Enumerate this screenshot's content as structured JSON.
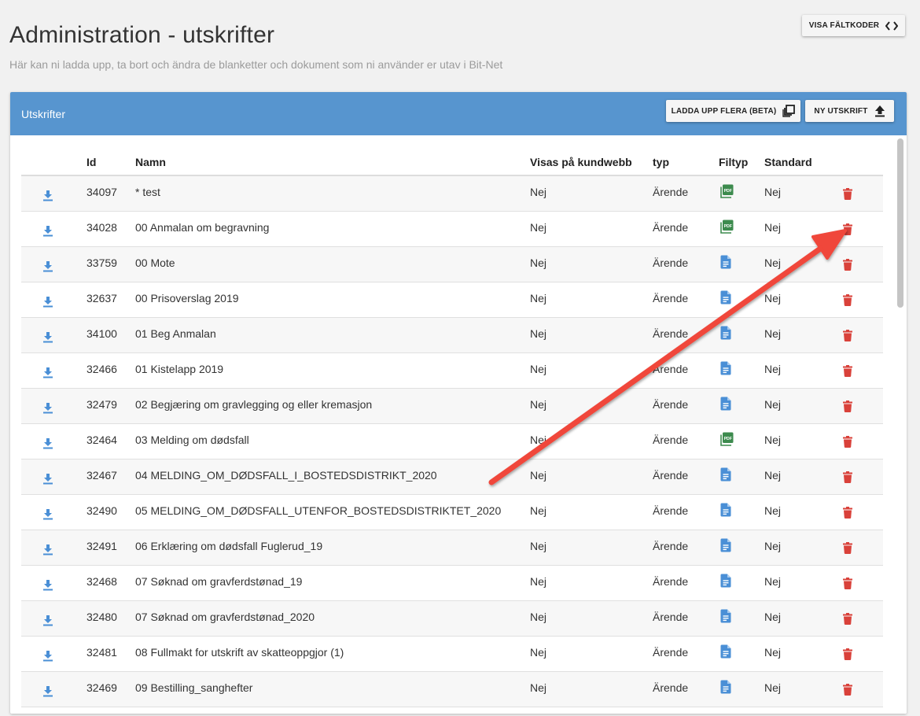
{
  "page": {
    "title": "Administration - utskrifter",
    "subtitle": "Här kan ni ladda upp, ta bort och ändra de blanketter och dokument som ni använder er utav i Bit-Net"
  },
  "toolbar": {
    "show_fields_label": "VISA FÄLTKODER"
  },
  "card": {
    "title": "Utskrifter",
    "upload_many_label": "LADDA UPP FLERA (BETA)",
    "new_label": "NY UTSKRIFT"
  },
  "table": {
    "headers": {
      "id": "Id",
      "name": "Namn",
      "visible": "Visas på kundwebb",
      "type": "typ",
      "filetype": "Filtyp",
      "standard": "Standard"
    },
    "rows": [
      {
        "id": "34097",
        "name": "* test",
        "visible": "Nej",
        "type": "Ärende",
        "file": "pdf",
        "standard": "Nej"
      },
      {
        "id": "34028",
        "name": "00 Anmalan om begravning",
        "visible": "Nej",
        "type": "Ärende",
        "file": "pdf",
        "standard": "Nej"
      },
      {
        "id": "33759",
        "name": "00 Mote",
        "visible": "Nej",
        "type": "Ärende",
        "file": "doc",
        "standard": "Nej"
      },
      {
        "id": "32637",
        "name": "00 Prisoverslag 2019",
        "visible": "Nej",
        "type": "Ärende",
        "file": "doc",
        "standard": "Nej"
      },
      {
        "id": "34100",
        "name": "01 Beg Anmalan",
        "visible": "Nej",
        "type": "Ärende",
        "file": "doc",
        "standard": "Nej"
      },
      {
        "id": "32466",
        "name": "01 Kistelapp 2019",
        "visible": "Nej",
        "type": "Ärende",
        "file": "doc",
        "standard": "Nej"
      },
      {
        "id": "32479",
        "name": "02 Begjæring om gravlegging og eller kremasjon",
        "visible": "Nej",
        "type": "Ärende",
        "file": "doc",
        "standard": "Nej"
      },
      {
        "id": "32464",
        "name": "03 Melding om dødsfall",
        "visible": "Nej",
        "type": "Ärende",
        "file": "pdf",
        "standard": "Nej"
      },
      {
        "id": "32467",
        "name": "04 MELDING_OM_DØDSFALL_I_BOSTEDSDISTRIKT_2020",
        "visible": "Nej",
        "type": "Ärende",
        "file": "doc",
        "standard": "Nej"
      },
      {
        "id": "32490",
        "name": "05 MELDING_OM_DØDSFALL_UTENFOR_BOSTEDSDISTRIKTET_2020",
        "visible": "Nej",
        "type": "Ärende",
        "file": "doc",
        "standard": "Nej"
      },
      {
        "id": "32491",
        "name": "06 Erklæring om dødsfall Fuglerud_19",
        "visible": "Nej",
        "type": "Ärende",
        "file": "doc",
        "standard": "Nej"
      },
      {
        "id": "32468",
        "name": "07 Søknad om gravferdstønad_19",
        "visible": "Nej",
        "type": "Ärende",
        "file": "doc",
        "standard": "Nej"
      },
      {
        "id": "32480",
        "name": "07 Søknad om gravferdstønad_2020",
        "visible": "Nej",
        "type": "Ärende",
        "file": "doc",
        "standard": "Nej"
      },
      {
        "id": "32481",
        "name": "08 Fullmakt for utskrift av skatteoppgjor (1)",
        "visible": "Nej",
        "type": "Ärende",
        "file": "doc",
        "standard": "Nej"
      },
      {
        "id": "32469",
        "name": "09 Bestilling_sanghefter",
        "visible": "Nej",
        "type": "Ärende",
        "file": "doc",
        "standard": "Nej"
      }
    ]
  },
  "colors": {
    "header_blue": "#5795cf",
    "icon_blue": "#4a8fd6",
    "pdf_green": "#3d8b4e",
    "delete_red": "#d9413a",
    "arrow_red": "#f0463a"
  },
  "icons": {
    "download": "download-icon",
    "pdf": "pdf-file-icon",
    "doc": "document-file-icon",
    "delete": "trash-icon",
    "upload": "upload-icon",
    "copy": "multiple-files-icon",
    "code": "code-brackets-icon"
  }
}
